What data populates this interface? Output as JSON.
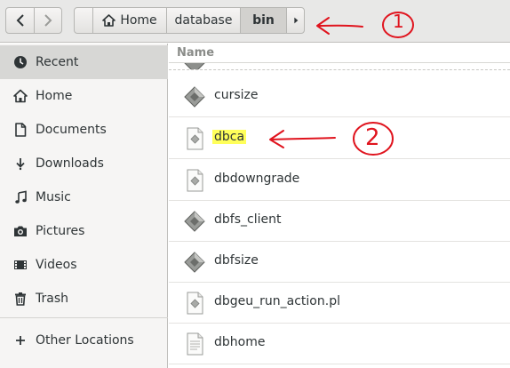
{
  "navigation": {
    "back_icon": "chevron-left-icon",
    "forward_icon": "chevron-right-icon"
  },
  "pathbar": {
    "home_label": "Home",
    "home_icon": "home-icon",
    "crumbs": [
      "database",
      "bin"
    ],
    "more_icon": "chevron-right-icon"
  },
  "sidebar": {
    "items": [
      {
        "label": "Recent",
        "icon": "clock-icon",
        "active": true
      },
      {
        "label": "Home",
        "icon": "home-icon"
      },
      {
        "label": "Documents",
        "icon": "document-icon"
      },
      {
        "label": "Downloads",
        "icon": "download-icon"
      },
      {
        "label": "Music",
        "icon": "music-icon"
      },
      {
        "label": "Pictures",
        "icon": "camera-icon"
      },
      {
        "label": "Videos",
        "icon": "video-icon"
      },
      {
        "label": "Trash",
        "icon": "trash-icon"
      },
      {
        "label": "Other Locations",
        "icon": "plus-icon"
      }
    ]
  },
  "file_list": {
    "column_name": "Name",
    "files": [
      {
        "name": "cursize",
        "icon": "executable-icon"
      },
      {
        "name": "dbca",
        "icon": "script-icon",
        "highlighted": true
      },
      {
        "name": "dbdowngrade",
        "icon": "script-icon"
      },
      {
        "name": "dbfs_client",
        "icon": "executable-icon"
      },
      {
        "name": "dbfsize",
        "icon": "executable-icon"
      },
      {
        "name": "dbgeu_run_action.pl",
        "icon": "script-icon"
      },
      {
        "name": "dbhome",
        "icon": "text-file-icon"
      }
    ]
  },
  "annotations": {
    "pathbar_marker": "1",
    "file_marker": "2",
    "color": "#e0141e",
    "highlight_color": "#ffff5a"
  }
}
